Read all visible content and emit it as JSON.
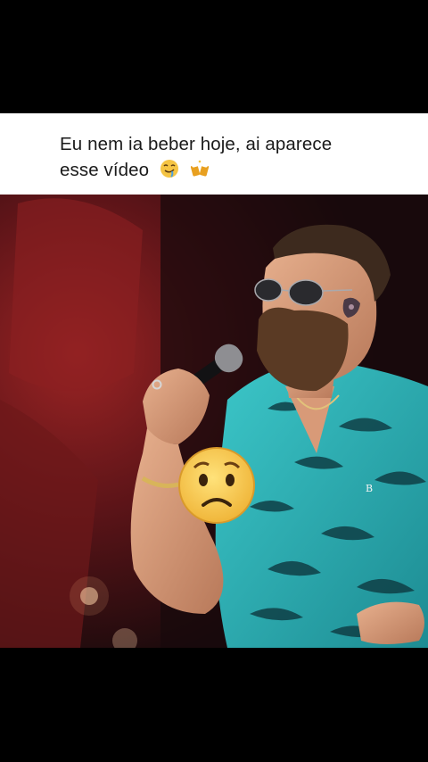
{
  "post": {
    "caption_line1": "Eu nem ia beber hoje, ai aparece",
    "caption_line2": "esse vídeo",
    "caption_emojis": [
      "drooling-face-emoji",
      "beer-toast-emoji"
    ]
  },
  "video": {
    "overlay_emoji": "worried-face-emoji",
    "shirt_monogram": "B"
  },
  "colors": {
    "caption_bg": "#ffffff",
    "caption_text": "#1a1a1a",
    "letterbox": "#000000",
    "stage_red": "#7a1a1c",
    "shirt_teal": "#2fb5b9",
    "emoji_yellow": "#f5c443"
  }
}
